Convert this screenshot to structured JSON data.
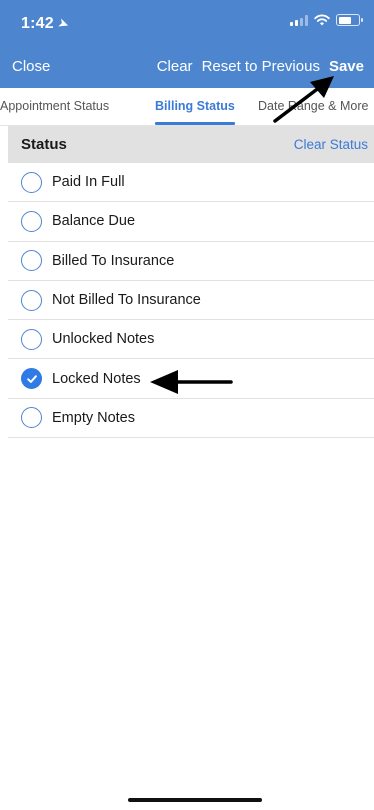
{
  "status_bar": {
    "time": "1:42",
    "location_icon": "location-arrow-icon",
    "icons": [
      "cellular-signal-icon",
      "wifi-icon",
      "battery-icon"
    ]
  },
  "nav": {
    "close": "Close",
    "clear": "Clear",
    "reset": "Reset to Previous",
    "save": "Save"
  },
  "tabs": [
    {
      "label": "Appointment Status",
      "selected": false
    },
    {
      "label": "Billing Status",
      "selected": true
    },
    {
      "label": "Date Range & More",
      "selected": false
    }
  ],
  "section": {
    "title": "Status",
    "clear_label": "Clear Status"
  },
  "options": [
    {
      "label": "Paid In Full",
      "checked": false
    },
    {
      "label": "Balance Due",
      "checked": false
    },
    {
      "label": "Billed To Insurance",
      "checked": false
    },
    {
      "label": "Not Billed To Insurance",
      "checked": false
    },
    {
      "label": "Unlocked Notes",
      "checked": false
    },
    {
      "label": "Locked Notes",
      "checked": true
    },
    {
      "label": "Empty Notes",
      "checked": false
    }
  ],
  "colors": {
    "header_bg": "#4d86cf",
    "accent": "#3b7bd8",
    "section_bg": "#e1e1e1"
  }
}
